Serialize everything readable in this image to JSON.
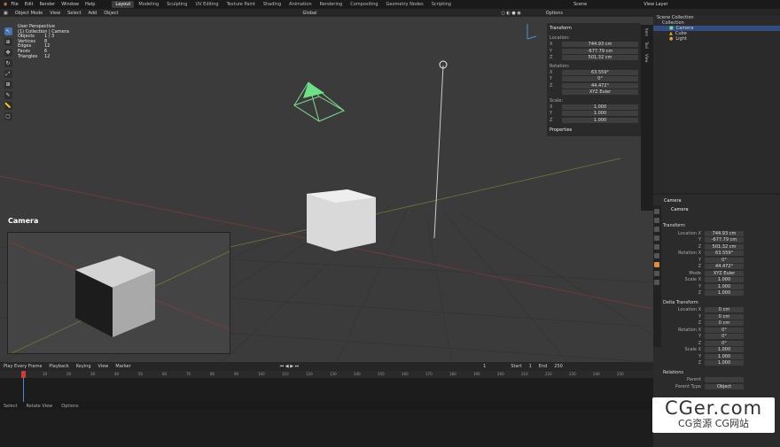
{
  "topbar": {
    "menu": [
      "File",
      "Edit",
      "Render",
      "Window",
      "Help"
    ],
    "workspaces": [
      "Layout",
      "Modeling",
      "Sculpting",
      "UV Editing",
      "Texture Paint",
      "Shading",
      "Animation",
      "Rendering",
      "Compositing",
      "Geometry Nodes",
      "Scripting"
    ],
    "active_workspace": "Layout",
    "scene": "Scene",
    "view_layer": "View Layer"
  },
  "viewport_header": {
    "mode": "Object Mode",
    "menus": [
      "View",
      "Select",
      "Add",
      "Object"
    ],
    "transform_orientation": "Global",
    "options": "Options"
  },
  "overlay": {
    "view": "User Perspective",
    "collection": "(1) Collection | Camera",
    "stats": [
      {
        "k": "Objects",
        "v": "1 / 3"
      },
      {
        "k": "Vertices",
        "v": "8"
      },
      {
        "k": "Edges",
        "v": "12"
      },
      {
        "k": "Faces",
        "v": "6"
      },
      {
        "k": "Triangles",
        "v": "12"
      }
    ]
  },
  "n_panel": {
    "title": "Transform",
    "location_label": "Location:",
    "location": [
      {
        "l": "X",
        "v": "744.93 cm"
      },
      {
        "l": "Y",
        "v": "-677.79 cm"
      },
      {
        "l": "Z",
        "v": "501.32 cm"
      }
    ],
    "rotation_label": "Rotation:",
    "rotation": [
      {
        "l": "X",
        "v": "63.559°"
      },
      {
        "l": "Y",
        "v": "0°"
      },
      {
        "l": "Z",
        "v": "44.472°"
      }
    ],
    "rotation_mode": "XYZ Euler",
    "scale_label": "Scale:",
    "scale": [
      {
        "l": "X",
        "v": "1.000"
      },
      {
        "l": "Y",
        "v": "1.000"
      },
      {
        "l": "Z",
        "v": "1.000"
      }
    ],
    "properties": "Properties",
    "tabs": [
      "Item",
      "Tool",
      "View"
    ]
  },
  "camera_view_label": "Camera",
  "timeline": {
    "play_mode": "Play Every Frame",
    "menus": [
      "Playback",
      "Keying",
      "View",
      "Marker"
    ],
    "current_frame": "1",
    "start_label": "Start",
    "start": "1",
    "end_label": "End",
    "end": "250",
    "ruler": [
      "10",
      "20",
      "30",
      "40",
      "50",
      "60",
      "70",
      "80",
      "90",
      "100",
      "110",
      "120",
      "130",
      "140",
      "150",
      "160",
      "170",
      "180",
      "190",
      "200",
      "210",
      "220",
      "230",
      "240",
      "250"
    ]
  },
  "status": [
    "Select",
    "Rotate View",
    "Options"
  ],
  "outliner": {
    "search_placeholder": "",
    "items": [
      {
        "label": "Scene Collection",
        "indent": 0
      },
      {
        "label": "Collection",
        "indent": 1
      },
      {
        "label": "Camera",
        "indent": 2,
        "selected": true
      },
      {
        "label": "Cube",
        "indent": 2
      },
      {
        "label": "Light",
        "indent": 2
      }
    ]
  },
  "properties": {
    "object_name": "Camera",
    "data_name": "Camera",
    "transform_title": "Transform",
    "location_label": "Location X",
    "location": [
      {
        "l": "Location X",
        "v": "744.93 cm"
      },
      {
        "l": "Y",
        "v": "-677.79 cm"
      },
      {
        "l": "Z",
        "v": "501.32 cm"
      }
    ],
    "rotation": [
      {
        "l": "Rotation X",
        "v": "63.559°"
      },
      {
        "l": "Y",
        "v": "0°"
      },
      {
        "l": "Z",
        "v": "44.472°"
      }
    ],
    "mode": {
      "l": "Mode",
      "v": "XYZ Euler"
    },
    "scale": [
      {
        "l": "Scale X",
        "v": "1.000"
      },
      {
        "l": "Y",
        "v": "1.000"
      },
      {
        "l": "Z",
        "v": "1.000"
      }
    ],
    "delta_title": "Delta Transform",
    "delta_location": [
      {
        "l": "Location X",
        "v": "0 cm"
      },
      {
        "l": "Y",
        "v": "0 cm"
      },
      {
        "l": "Z",
        "v": "0 cm"
      }
    ],
    "delta_rotation": [
      {
        "l": "Rotation X",
        "v": "0°"
      },
      {
        "l": "Y",
        "v": "0°"
      },
      {
        "l": "Z",
        "v": "0°"
      }
    ],
    "delta_scale": [
      {
        "l": "Scale X",
        "v": "1.000"
      },
      {
        "l": "Y",
        "v": "1.000"
      },
      {
        "l": "Z",
        "v": "1.000"
      }
    ],
    "relations_title": "Relations",
    "parent_label": "Parent",
    "parent_type_label": "Parent Type",
    "parent_type": "Object"
  },
  "watermark": {
    "big": "CGer.com",
    "small": "CG资源 CG网站"
  }
}
